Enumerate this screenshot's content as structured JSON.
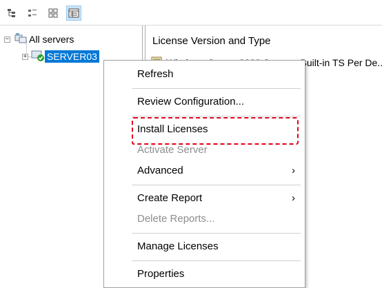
{
  "tree": {
    "root_label": "All servers",
    "child_label": "SERVER03"
  },
  "content": {
    "column_header": "License Version and Type",
    "row_text": "Windows Server 2008 Server - Built-in TS Per De..."
  },
  "context_menu": {
    "items": [
      {
        "label": "Refresh",
        "enabled": true
      },
      {
        "label": "Review Configuration...",
        "enabled": true
      },
      {
        "label": "Install Licenses",
        "enabled": true,
        "highlighted": true
      },
      {
        "label": "Activate Server",
        "enabled": false
      },
      {
        "label": "Advanced",
        "enabled": true,
        "submenu": true
      },
      {
        "label": "Create Report",
        "enabled": true,
        "submenu": true
      },
      {
        "label": "Delete Reports...",
        "enabled": false
      },
      {
        "label": "Manage Licenses",
        "enabled": true
      },
      {
        "label": "Properties",
        "enabled": true
      }
    ],
    "submenu_arrow": "›"
  },
  "colors": {
    "selection": "#0078d7",
    "highlight_box": "#e0001a",
    "disabled_text": "#8d8d8d"
  }
}
